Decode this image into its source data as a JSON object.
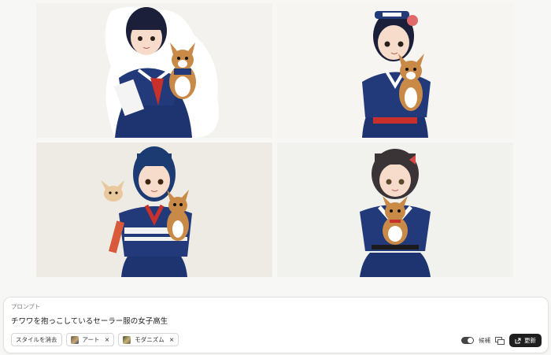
{
  "gallery": {
    "images": [
      {
        "icon": "illustration-girl-chihuahua-1"
      },
      {
        "icon": "illustration-girl-chihuahua-2"
      },
      {
        "icon": "illustration-girl-chihuahua-3"
      },
      {
        "icon": "illustration-girl-chihuahua-4"
      }
    ]
  },
  "prompt": {
    "label": "プロンプト",
    "text": "チワワを抱っこしているセーラー服の女子高生"
  },
  "chips": [
    {
      "label": "スタイルを消去"
    },
    {
      "label": "アート",
      "close": "×"
    },
    {
      "label": "モダニズム",
      "close": "×"
    }
  ],
  "controls": {
    "toggle_label": "候補",
    "update_label": "更新"
  },
  "colors": {
    "uniform_navy": "#1e3470",
    "button_dark": "#1f1f1f"
  }
}
